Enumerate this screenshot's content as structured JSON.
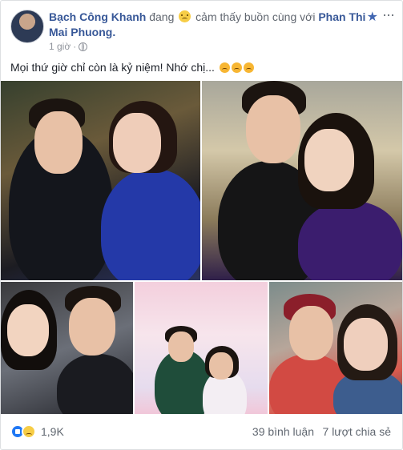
{
  "post": {
    "author": "Bạch Công Khanh",
    "feeling_prefix": "đang",
    "feeling_text": "cảm thấy buồn cùng với",
    "tagged": "Phan Thi Mai Phuong.",
    "time": "1 giờ",
    "separator": "·",
    "text": "Mọi thứ giờ chỉ còn là kỷ niệm! Nhớ chị...",
    "icons": {
      "privacy": "globe-icon",
      "save": "star-icon",
      "menu": "more-options-icon",
      "feeling": "sad-face-emoji",
      "reaction_like": "like-icon",
      "reaction_sad": "sad-reaction-icon"
    }
  },
  "footer": {
    "reaction_count": "1,9K",
    "comments": "39 bình luận",
    "shares": "7 lượt chia sẻ"
  },
  "colors": {
    "link": "#385898",
    "muted": "#90949c",
    "like_blue": "#2078f4"
  }
}
